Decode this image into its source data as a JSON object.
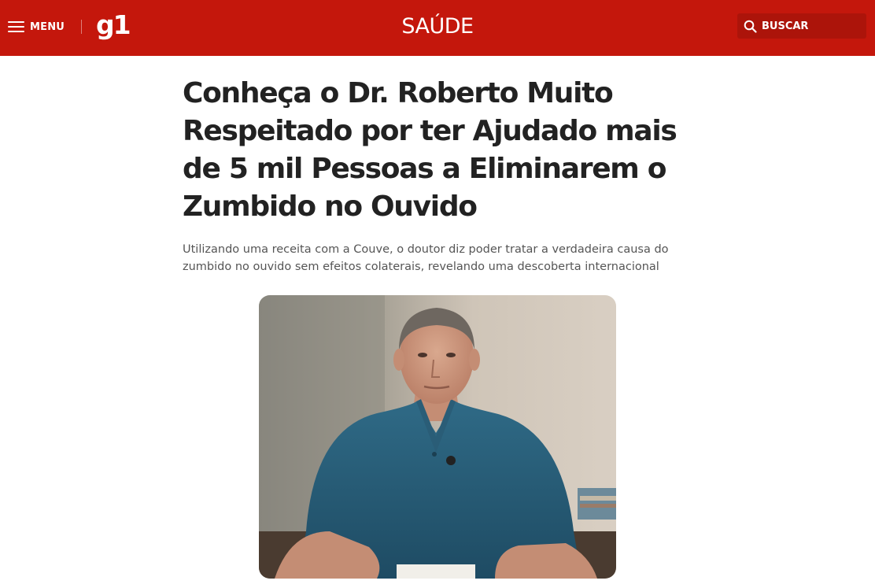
{
  "header": {
    "menu_label": "MENU",
    "logo_text": "g1",
    "section_title": "SAÚDE",
    "search_label": "BUSCAR",
    "brand_color": "#c4170c"
  },
  "article": {
    "headline": "Conheça o Dr. Roberto Muito Respeitado por ter Ajudado mais de 5 mil Pessoas a Eliminarem o Zumbido no Ouvido",
    "summary": "Utilizando uma receita com a Couve, o doutor diz poder tratar a verdadeira causa do zumbido no ouvido sem efeitos colaterais, revelando uma descoberta internacional"
  },
  "icons": {
    "menu": "hamburger-icon",
    "search": "search-icon"
  }
}
